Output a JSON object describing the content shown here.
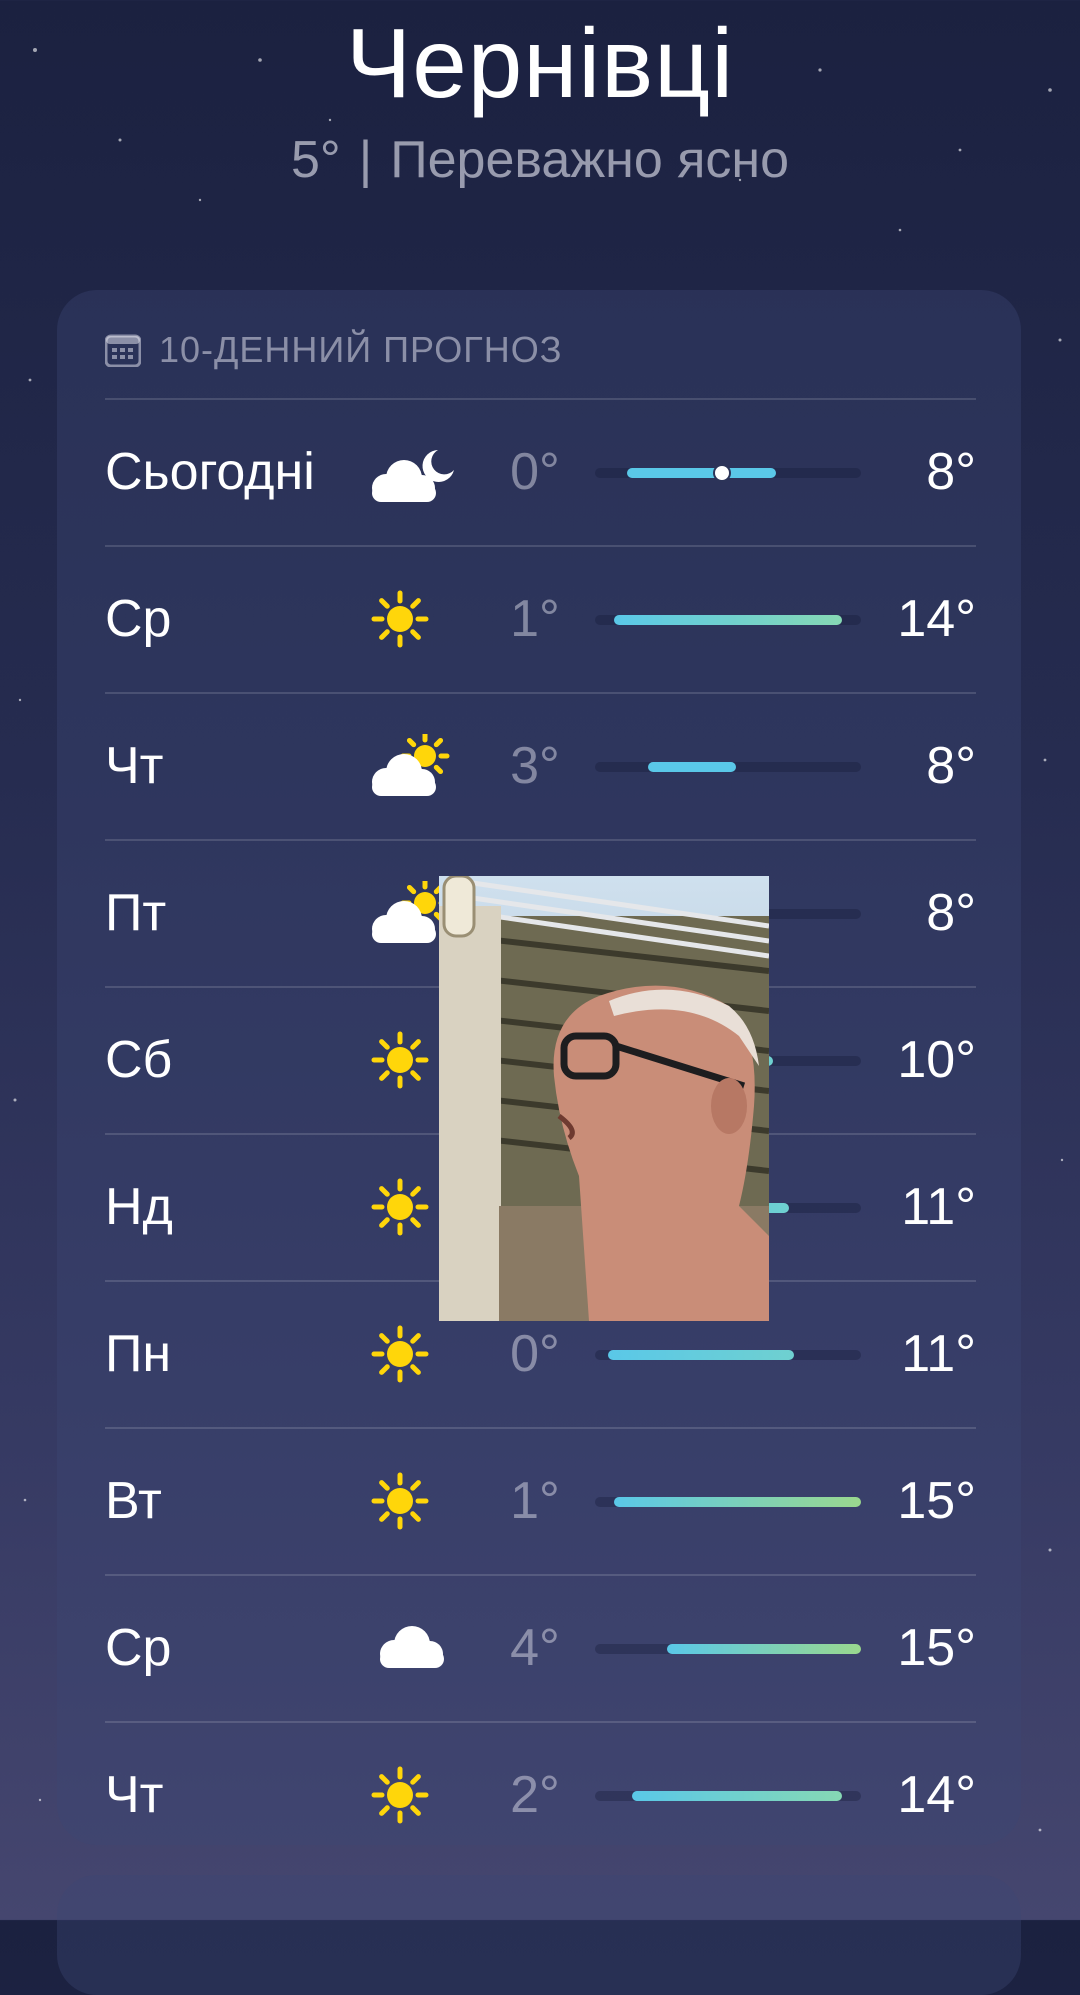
{
  "location": {
    "city": "Чернівці",
    "temp": "5°",
    "separator": "|",
    "condition": "Переважно ясно"
  },
  "forecast": {
    "header": "10-ДЕННИЙ ПРОГНОЗ",
    "header_icon": "calendar-icon",
    "scale_range": [
      0,
      15
    ],
    "days": [
      {
        "day": "Сьогодні",
        "icon": "cloud-moon-icon",
        "lo_label": "0°",
        "hi_label": "8°",
        "lo": 0,
        "hi": 8,
        "current": 5,
        "bar_start": 0.12,
        "bar_end": 0.68,
        "colors": [
          "#5ac8e8",
          "#5ac8e8"
        ]
      },
      {
        "day": "Ср",
        "icon": "sun-icon",
        "lo_label": "1°",
        "hi_label": "14°",
        "lo": 1,
        "hi": 14,
        "bar_start": 0.07,
        "bar_end": 0.93,
        "colors": [
          "#5ac8e8",
          "#86d8b4"
        ]
      },
      {
        "day": "Чт",
        "icon": "cloud-sun-icon",
        "lo_label": "3°",
        "hi_label": "8°",
        "lo": 3,
        "hi": 8,
        "bar_start": 0.2,
        "bar_end": 0.53,
        "colors": [
          "#5ac8e8",
          "#5ac8e8"
        ]
      },
      {
        "day": "Пт",
        "icon": "cloud-sun-icon",
        "lo_label": "",
        "hi_label": "8°",
        "lo": null,
        "hi": 8,
        "bar_start": 0.2,
        "bar_end": 0.53,
        "colors": [
          "#5ac8e8",
          "#5ac8e8"
        ]
      },
      {
        "day": "Сб",
        "icon": "sun-icon",
        "lo_label": "",
        "hi_label": "10°",
        "lo": null,
        "hi": 10,
        "bar_start": 0.2,
        "bar_end": 0.67,
        "colors": [
          "#5ac8e8",
          "#6fd0d0"
        ]
      },
      {
        "day": "Нд",
        "icon": "sun-icon",
        "lo_label": "",
        "hi_label": "11°",
        "lo": null,
        "hi": 11,
        "bar_start": 0.2,
        "bar_end": 0.73,
        "colors": [
          "#5ac8e8",
          "#6fd0d0"
        ]
      },
      {
        "day": "Пн",
        "icon": "sun-icon",
        "lo_label": "0°",
        "hi_label": "11°",
        "lo": 0,
        "hi": 11,
        "bar_start": 0.05,
        "bar_end": 0.75,
        "colors": [
          "#5ac8e8",
          "#6fd0d0"
        ]
      },
      {
        "day": "Вт",
        "icon": "sun-icon",
        "lo_label": "1°",
        "hi_label": "15°",
        "lo": 1,
        "hi": 15,
        "bar_start": 0.07,
        "bar_end": 1.0,
        "colors": [
          "#5ac8e8",
          "#9ad88e"
        ]
      },
      {
        "day": "Ср",
        "icon": "cloud-icon",
        "lo_label": "4°",
        "hi_label": "15°",
        "lo": 4,
        "hi": 15,
        "bar_start": 0.27,
        "bar_end": 1.0,
        "colors": [
          "#5ac8e8",
          "#9ad88e"
        ]
      },
      {
        "day": "Чт",
        "icon": "sun-icon",
        "lo_label": "2°",
        "hi_label": "14°",
        "lo": 2,
        "hi": 14,
        "bar_start": 0.14,
        "bar_end": 0.93,
        "colors": [
          "#5ac8e8",
          "#86d8b4"
        ]
      }
    ]
  },
  "overlay": {
    "type": "video-thumbnail",
    "icon": "person-video-overlay"
  },
  "colors": {
    "accent_cool": "#5ac8e8",
    "accent_warm": "#9ad88e",
    "sun": "#ffd60a"
  }
}
